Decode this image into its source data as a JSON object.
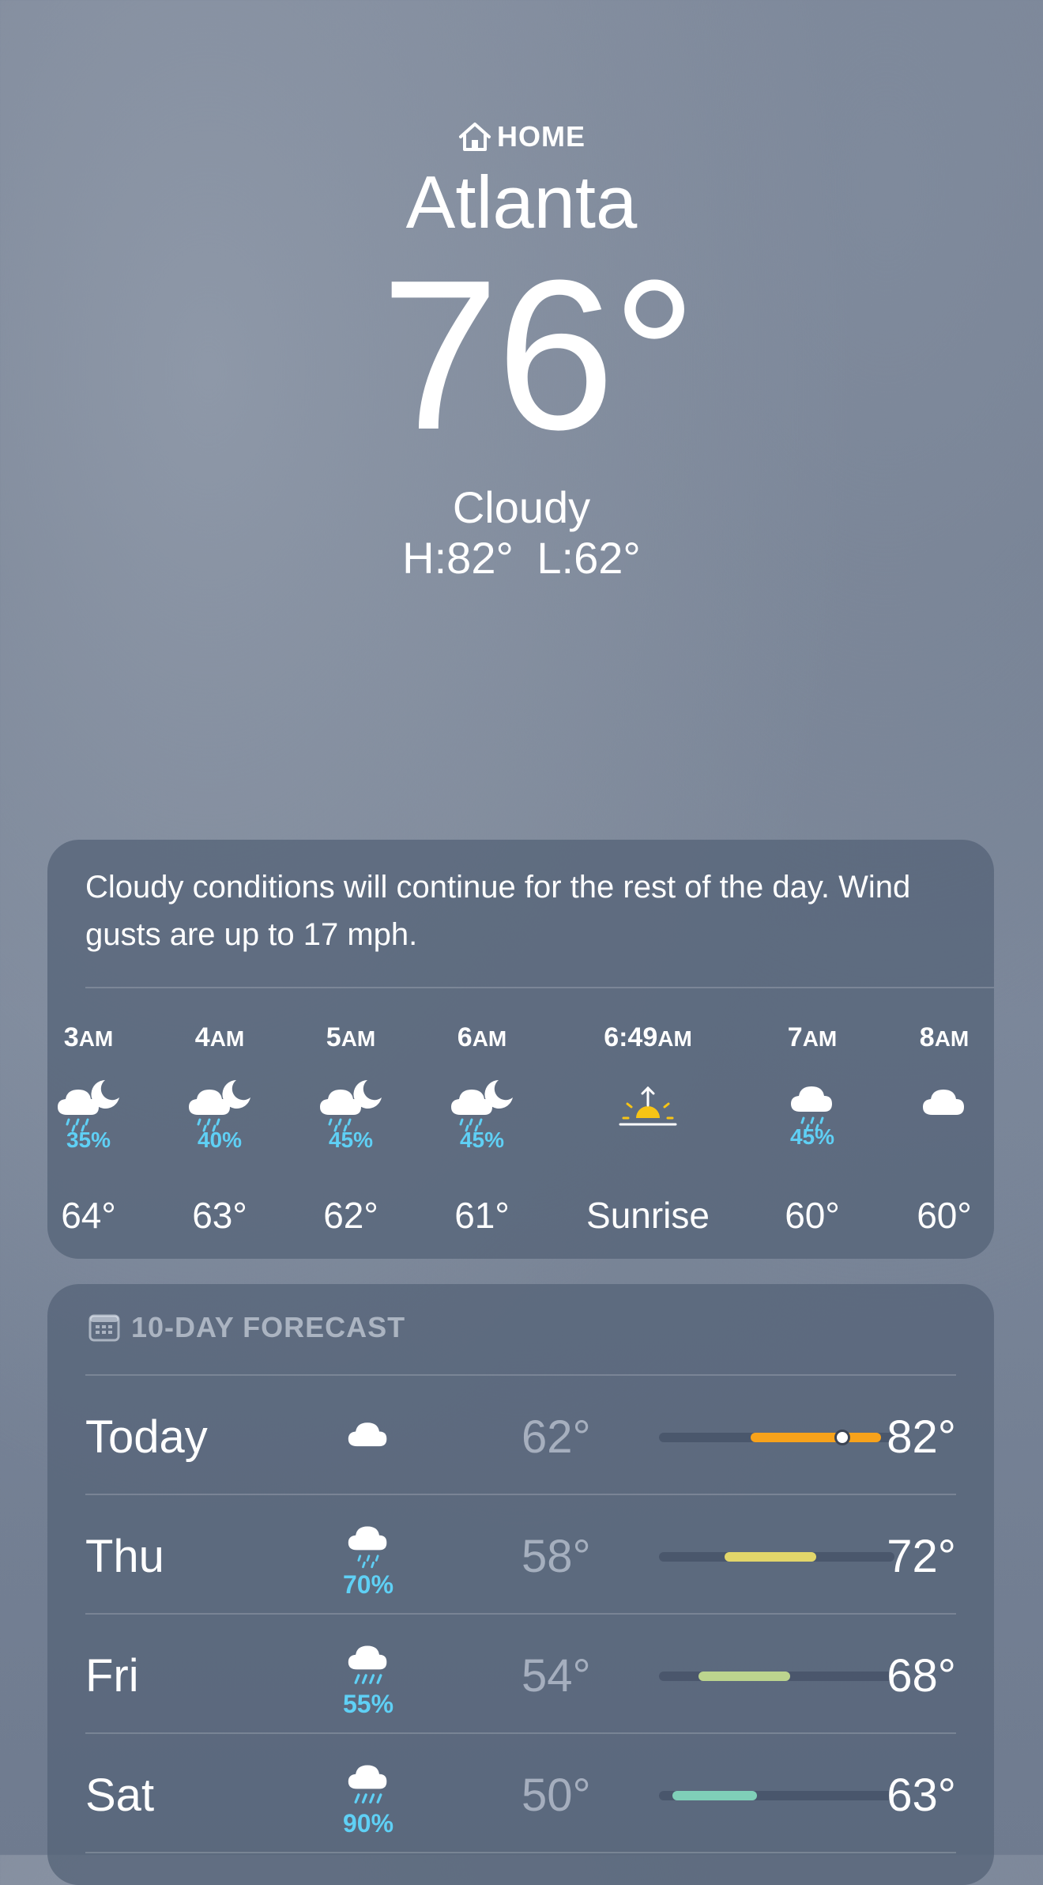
{
  "header": {
    "location_label": "HOME",
    "city": "Atlanta",
    "temperature": "76°",
    "condition": "Cloudy",
    "high_low": "H:82°  L:62°"
  },
  "hourly": {
    "summary": "Cloudy conditions will continue for the rest of the day. Wind gusts are up to 17 mph.",
    "items": [
      {
        "time": "3",
        "suffix": "AM",
        "icon": "cloud-moon-rain-icon",
        "precip": "35%",
        "temp": "64°"
      },
      {
        "time": "4",
        "suffix": "AM",
        "icon": "cloud-moon-rain-icon",
        "precip": "40%",
        "temp": "63°"
      },
      {
        "time": "5",
        "suffix": "AM",
        "icon": "cloud-moon-rain-icon",
        "precip": "45%",
        "temp": "62°"
      },
      {
        "time": "6",
        "suffix": "AM",
        "icon": "cloud-moon-rain-icon",
        "precip": "45%",
        "temp": "61°"
      },
      {
        "time": "6:49",
        "suffix": "AM",
        "icon": "sunrise-icon",
        "precip": "",
        "temp": "Sunrise"
      },
      {
        "time": "7",
        "suffix": "AM",
        "icon": "cloud-rain-icon",
        "precip": "45%",
        "temp": "60°"
      },
      {
        "time": "8",
        "suffix": "AM",
        "icon": "cloud-icon",
        "precip": "",
        "temp": "60°"
      }
    ]
  },
  "forecast": {
    "title": "10-DAY FORECAST",
    "days": [
      {
        "day": "Today",
        "icon": "cloud-icon",
        "precip": "",
        "low": "62°",
        "high": "82°",
        "current_temp": 76
      },
      {
        "day": "Thu",
        "icon": "cloud-rain-icon",
        "precip": "70%",
        "low": "58°",
        "high": "72°"
      },
      {
        "day": "Fri",
        "icon": "cloud-heavy-rain-icon",
        "precip": "55%",
        "low": "54°",
        "high": "68°"
      },
      {
        "day": "Sat",
        "icon": "cloud-heavy-rain-icon",
        "precip": "90%",
        "low": "50°",
        "high": "63°"
      }
    ]
  },
  "colors": {
    "precip_blue": "#5fd0f5",
    "today_bar": "#f7a21b",
    "thu_bar": "#e2d66a",
    "fri_bar": "#bcd48e",
    "sat_bar": "#7fcfb8",
    "sun_yellow": "#f7c415"
  }
}
